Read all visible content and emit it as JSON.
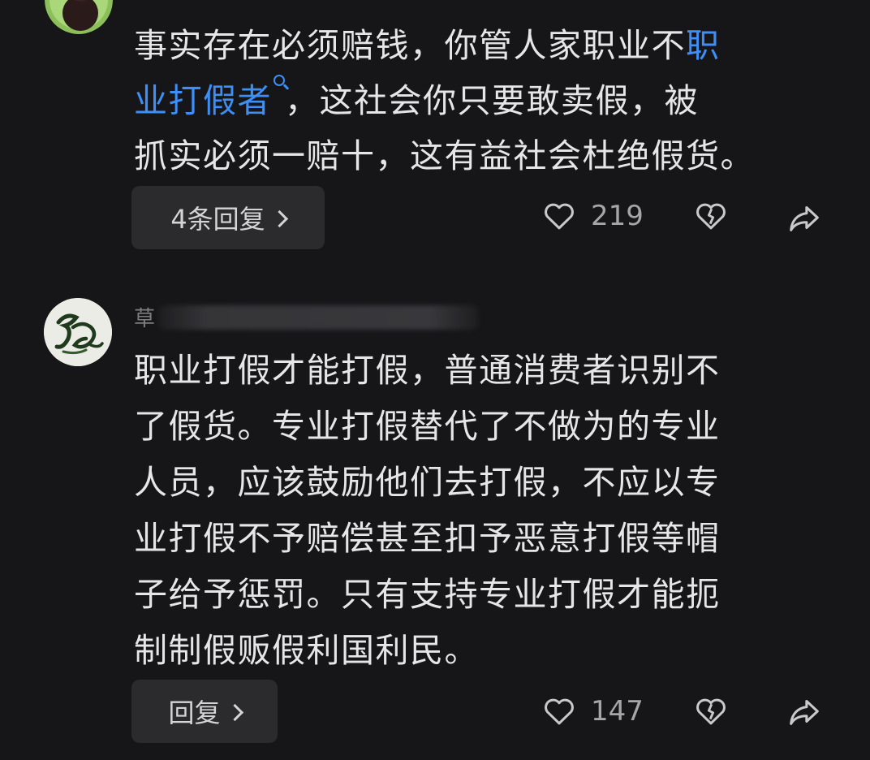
{
  "comments": [
    {
      "username": "",
      "body_lines": [
        {
          "before": "事实存在必须赔钱，你管人家职业不",
          "link": "职",
          "after": ""
        },
        {
          "before": "",
          "link": "业打假者",
          "after": "，这社会你只要敢卖假，被"
        },
        {
          "before": "抓实必须一赔十，这有益社会杜绝假货。",
          "link": "",
          "after": ""
        }
      ],
      "reply_label": "4条回复",
      "like_count": "219"
    },
    {
      "username": "草",
      "body_lines": [
        {
          "text": "职业打假才能打假，普通消费者识别不"
        },
        {
          "text": "了假货。专业打假替代了不做为的专业"
        },
        {
          "text": "人员，应该鼓励他们去打假，不应以专"
        },
        {
          "text": "业打假不予赔偿甚至扣予恶意打假等帽"
        },
        {
          "text": "子给予惩罚。只有支持专业打假才能扼"
        },
        {
          "text": "制制假贩假利国利民。"
        }
      ],
      "reply_label": "回复",
      "like_count": "147"
    }
  ],
  "icons": {
    "like": "heart-icon",
    "dislike": "broken-heart-icon",
    "share": "share-arrow-icon",
    "search_link": "search-icon",
    "chevron": "chevron-right-icon"
  },
  "colors": {
    "background": "#161618",
    "link": "#3d8ff7",
    "button_bg": "#2b2b2e"
  }
}
